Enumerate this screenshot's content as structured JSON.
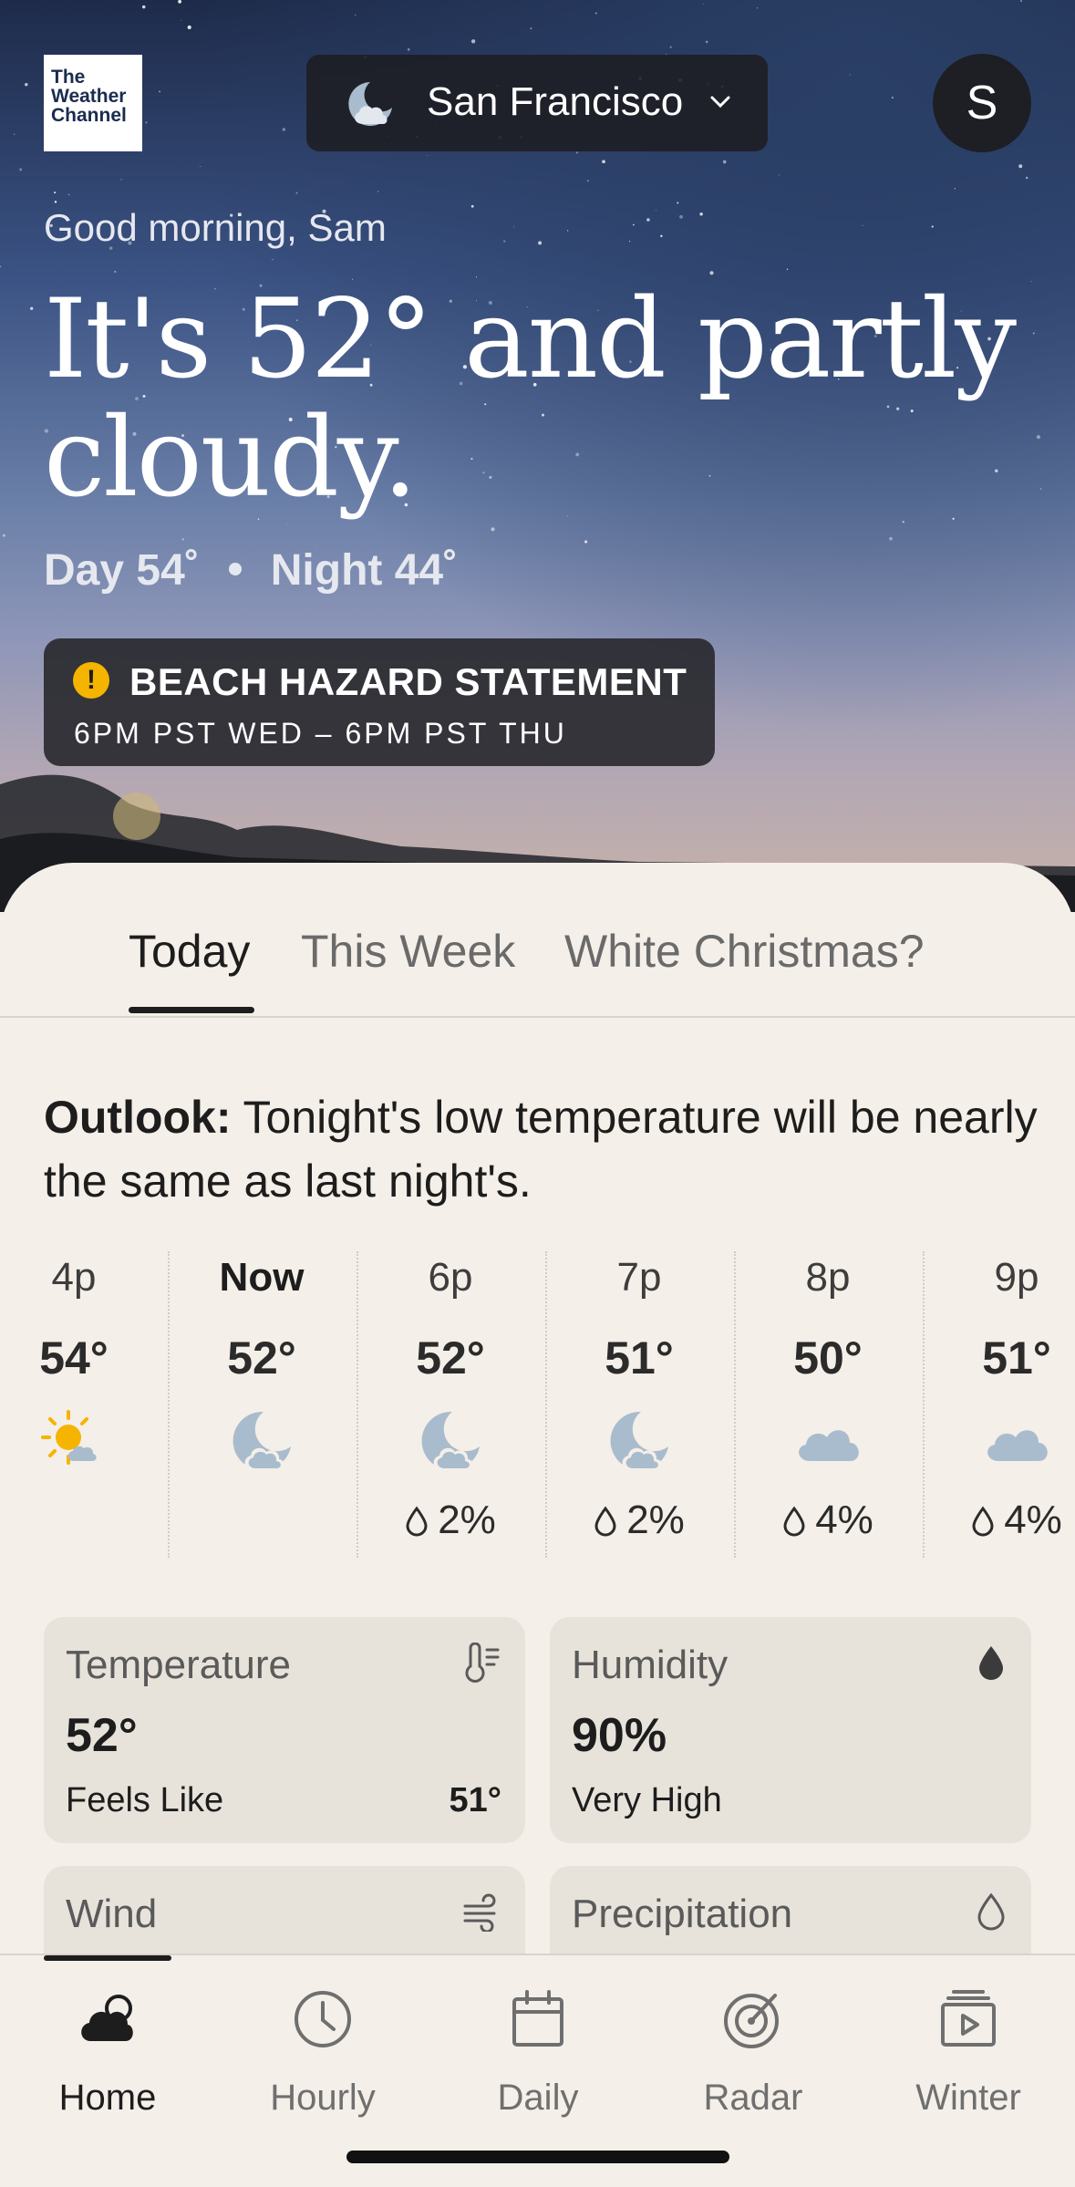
{
  "header": {
    "logo_lines": [
      "The",
      "Weather",
      "Channel"
    ],
    "location": "San Francisco",
    "avatar_initial": "S",
    "greeting": "Good morning, Sam",
    "headline": "It's 52° and partly cloudy.",
    "day": "Day 54˚",
    "night": "Night 44˚"
  },
  "alert": {
    "title": "BEACH HAZARD STATEMENT",
    "time": "6PM PST WED – 6PM PST THU",
    "color": "#f5b400"
  },
  "tabs": [
    {
      "label": "Today",
      "active": true
    },
    {
      "label": "This Week",
      "active": false
    },
    {
      "label": "White Christmas?",
      "active": false
    }
  ],
  "outlook": {
    "label": "Outlook:",
    "text": " Tonight's low temperature will be nearly the same as last night's."
  },
  "hourly": [
    {
      "time": "4p",
      "temp": "54°",
      "icon": "sun-cloud-icon",
      "precip": ""
    },
    {
      "time": "Now",
      "temp": "52°",
      "icon": "moon-cloud-icon",
      "precip": ""
    },
    {
      "time": "6p",
      "temp": "52°",
      "icon": "moon-cloud-icon",
      "precip": "2%"
    },
    {
      "time": "7p",
      "temp": "51°",
      "icon": "moon-cloud-icon",
      "precip": "2%"
    },
    {
      "time": "8p",
      "temp": "50°",
      "icon": "cloud-icon",
      "precip": "4%"
    },
    {
      "time": "9p",
      "temp": "51°",
      "icon": "cloud-icon",
      "precip": "4%"
    }
  ],
  "cards": {
    "temperature": {
      "label": "Temperature",
      "value": "52°",
      "sub": "Feels Like",
      "sub_value": "51°"
    },
    "humidity": {
      "label": "Humidity",
      "value": "90%",
      "sub": "Very High"
    },
    "wind": {
      "label": "Wind"
    },
    "precipitation": {
      "label": "Precipitation"
    }
  },
  "nav": [
    {
      "label": "Home",
      "icon": "cloud-moon-icon",
      "active": true
    },
    {
      "label": "Hourly",
      "icon": "clock-icon",
      "active": false
    },
    {
      "label": "Daily",
      "icon": "calendar-icon",
      "active": false
    },
    {
      "label": "Radar",
      "icon": "radar-icon",
      "active": false
    },
    {
      "label": "Winter",
      "icon": "video-icon",
      "active": false
    }
  ],
  "colors": {
    "accent_icon": "#a9bccd",
    "sun": "#f5b400",
    "sheet": "#f4efe8",
    "card": "#e7e3db"
  }
}
